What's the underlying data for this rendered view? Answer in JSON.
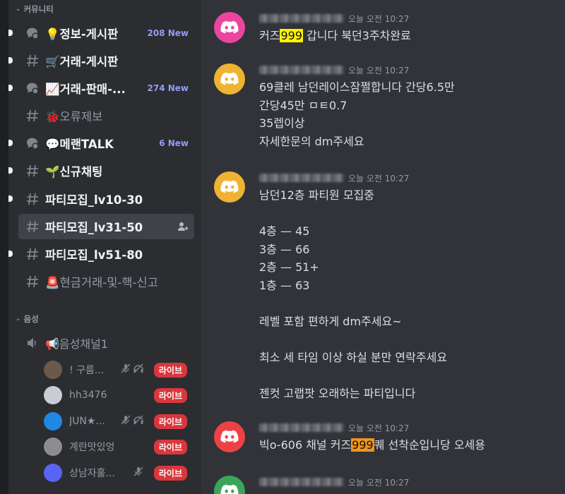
{
  "sidebar": {
    "categories": {
      "community": "커뮤니티",
      "voice": "음성"
    },
    "channels": [
      {
        "name": "💡정보-게시판",
        "badge": "208 New",
        "type": "forum",
        "unread": true
      },
      {
        "name": "🛒거래-게시판",
        "badge": "",
        "type": "text",
        "unread": true
      },
      {
        "name": "📈거래-판매-...",
        "badge": "274 New",
        "type": "forum",
        "unread": true
      },
      {
        "name": "🐞오류제보",
        "badge": "",
        "type": "text",
        "unread": false
      },
      {
        "name": "💬메랜TALK",
        "badge": "6 New",
        "type": "forum",
        "unread": true
      },
      {
        "name": "🌱신규채팅",
        "badge": "",
        "type": "text",
        "unread": true
      },
      {
        "name": "파티모집_lv10-30",
        "badge": "",
        "type": "text",
        "unread": true
      },
      {
        "name": "파티모집_lv31-50",
        "badge": "",
        "type": "text",
        "unread": false,
        "selected": true
      },
      {
        "name": "파티모집_lv51-80",
        "badge": "",
        "type": "text",
        "unread": true
      },
      {
        "name": "🚨현금거래-및-핵-신고",
        "badge": "",
        "type": "text",
        "unread": false
      }
    ],
    "voice_channel": {
      "name": "📢음성채널1"
    },
    "voice_users": [
      {
        "name": "! 구름...",
        "live": "라이브",
        "muted": true,
        "deafened": true,
        "avatar_color": "#6b5a4a"
      },
      {
        "name": "hh3476",
        "live": "라이브",
        "muted": false,
        "deafened": false,
        "avatar_color": "#c9ccd1"
      },
      {
        "name": "JUN★...",
        "live": "라이브",
        "muted": true,
        "deafened": true,
        "avatar_color": "#1e88e5"
      },
      {
        "name": "계란맛있엉",
        "live": "라이브",
        "muted": false,
        "deafened": false,
        "avatar_color": "#8d8d8d"
      },
      {
        "name": "상남자훌...",
        "live": "라이브",
        "muted": true,
        "deafened": false,
        "avatar_color": "#5865f2"
      }
    ]
  },
  "messages": [
    {
      "time": "오늘 오전 10:27",
      "avatar_color": "#eb459f",
      "lines": [
        {
          "pre": "커즈",
          "hl": "999",
          "post": " 갑니다 북던3주차완료",
          "style": "yellow"
        }
      ]
    },
    {
      "time": "오늘 오전 10:27",
      "avatar_color": "#f0b232",
      "lines": [
        {
          "text": "69클레 남던레이스잠쩔합니다 간당6.5만"
        },
        {
          "text": "간당45만 ㅁㅌ0.7"
        },
        {
          "text": "35렙이상"
        },
        {
          "text": "자세한문의 dm주세요"
        }
      ]
    },
    {
      "time": "오늘 오전 10:27",
      "avatar_color": "#f0b232",
      "lines": [
        {
          "text": "남던12층 파티원 모집중"
        },
        {
          "text": ""
        },
        {
          "text": "4층 — 45"
        },
        {
          "text": "3층 — 66"
        },
        {
          "text": "2층 — 51+"
        },
        {
          "text": "1층 — 63"
        },
        {
          "text": ""
        },
        {
          "text": "레벨 포함 편하게 dm주세요~"
        },
        {
          "text": ""
        },
        {
          "text": "최소 세 타임 이상 하실 분만 연락주세요"
        },
        {
          "text": ""
        },
        {
          "text": "젠컷 고랩팟 오래하는 파티입니다"
        }
      ]
    },
    {
      "time": "오늘 오전 10:27",
      "avatar_color": "#ed4245",
      "lines": [
        {
          "pre": "빅o-606 채널 커즈",
          "hl": "999",
          "post": "퀘 선착순입니당 오세용",
          "style": "orange"
        }
      ]
    },
    {
      "time": "오늘 오전 10:27",
      "avatar_color": "#3ba55c",
      "lines": []
    }
  ],
  "colors": {
    "accent_new": "#949cf7",
    "live": "#da373c",
    "highlight": "#fff200",
    "highlight_alt": "#f0961e"
  }
}
